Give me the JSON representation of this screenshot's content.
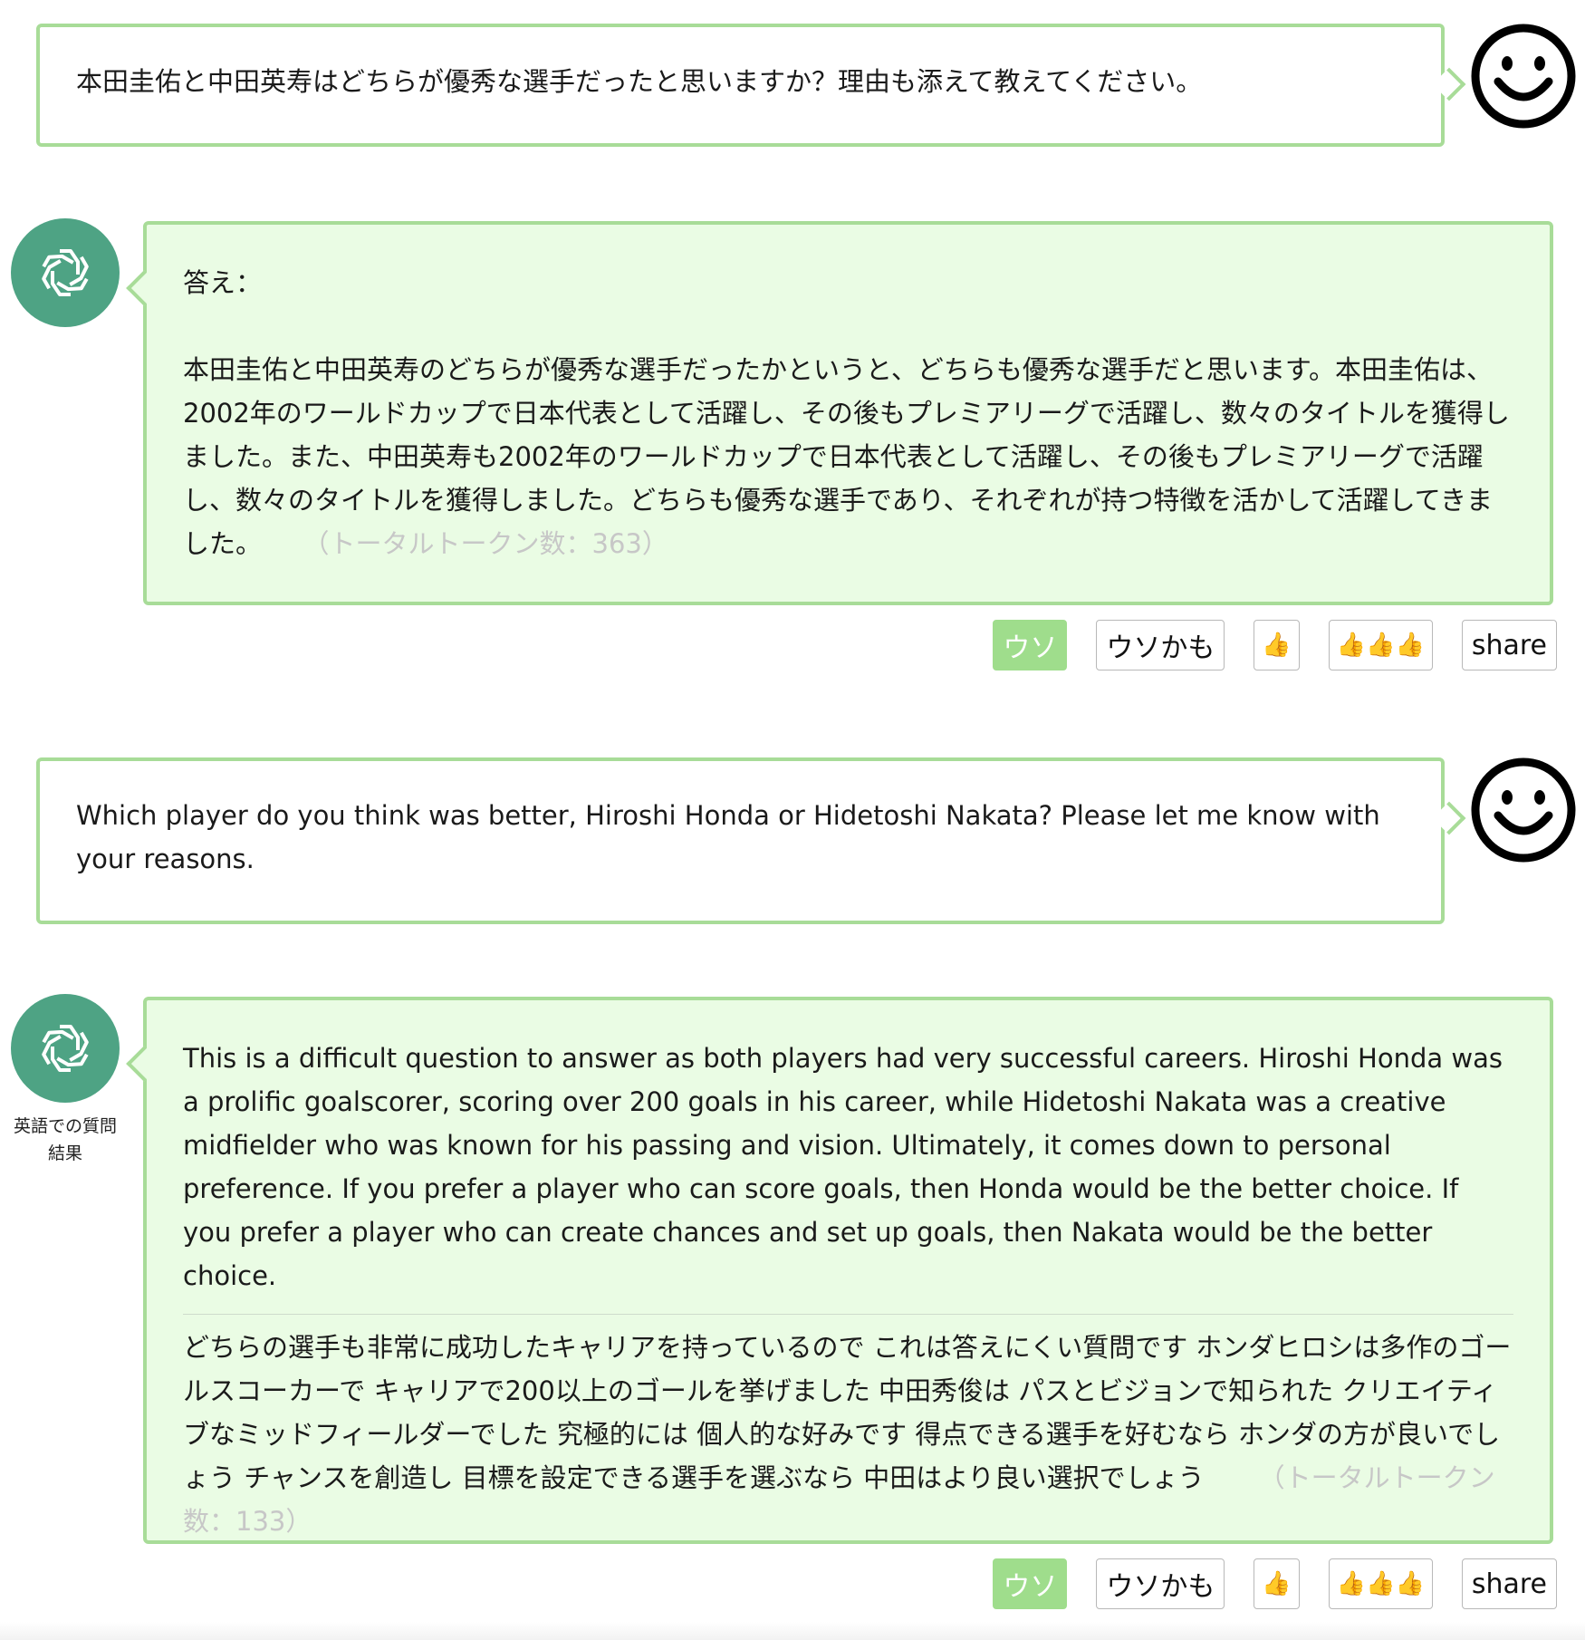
{
  "conversation": [
    {
      "question": "本田圭佑と中田英寿はどちらが優秀な選手だったと思いますか？理由も添えて教えてください。",
      "answer_label": "答え：",
      "answer": "本田圭佑と中田英寿のどちらが優秀な選手だったかというと、どちらも優秀な選手だと思います。本田圭佑は、2002年のワールドカップで日本代表として活躍し、その後もプレミアリーグで活躍し、数々のタイトルを獲得しました。また、中田英寿も2002年のワールドカップで日本代表として活躍し、その後もプレミアリーグで活躍し、数々のタイトルを獲得しました。どちらも優秀な選手であり、それぞれが持つ特徴を活かして活躍してきました。",
      "token_count": "（トータルトークン数：363）"
    },
    {
      "question": "Which player do you think was better, Hiroshi Honda or Hidetoshi Nakata? Please let me know with your reasons.",
      "answer_en": "This is a difficult question to answer as both players had very successful careers. Hiroshi Honda was a prolific goalscorer, scoring over 200 goals in his career, while Hidetoshi Nakata was a creative midfielder who was known for his passing and vision. Ultimately, it comes down to personal preference. If you prefer a player who can score goals, then Honda would be the better choice. If you prefer a player who can create chances and set up goals, then Nakata would be the better choice.",
      "answer_ja": "どちらの選手も非常に成功したキャリアを持っているので これは答えにくい質問です ホンダヒロシは多作のゴールスコーカーで キャリアで200以上のゴールを挙げました 中田秀俊は パスとビジョンで知られた クリエイティブなミッドフィールダーでした 究極的には 個人的な好みです 得点できる選手を好むなら ホンダの方が良いでしょう チャンスを創造し 目標を設定できる選手を選ぶなら 中田はより良い選択でしょう",
      "token_count": "（トータルトークン数：133）",
      "avatar_caption": "英語での質問結果"
    }
  ],
  "actions": {
    "lie": "ウソ",
    "maybe_lie": "ウソかも",
    "like": "👍",
    "triple_like": "👍👍👍",
    "share": "share"
  },
  "colors": {
    "bubble_border": "#a8dc98",
    "bot_bubble_bg": "#eafce4",
    "bot_avatar_bg": "#4ea384",
    "lie_button_bg": "#9fdd8c",
    "token_text": "#c7c7c7"
  },
  "icons": {
    "user_avatar": "smiley-face-icon",
    "bot_avatar": "openai-logo-icon"
  }
}
